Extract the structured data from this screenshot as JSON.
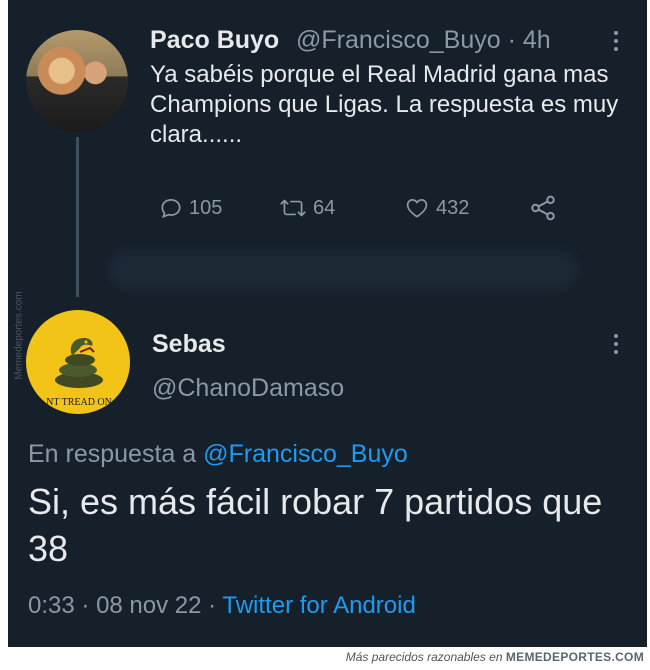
{
  "original_tweet": {
    "display_name": "Paco Buyo",
    "handle": "@Francisco_Buyo",
    "separator": "·",
    "time_ago": "4h",
    "text": "Ya sabéis porque el Real Madrid gana mas Champions que Ligas. La respuesta es muy clara......",
    "stats": {
      "replies": "105",
      "retweets": "64",
      "likes": "432"
    }
  },
  "reply_tweet": {
    "display_name": "Sebas",
    "handle": "@ChanoDamaso",
    "replying_to_prefix": "En respuesta a",
    "replying_to_handle": "@Francisco_Buyo",
    "text": "Si, es más fácil robar 7 partidos que 38",
    "time": "0:33",
    "separator": "·",
    "date": "08 nov 22",
    "source": "Twitter for Android",
    "avatar_caption": "NT TREAD ON"
  },
  "watermark": {
    "side": "Memedeportes.com",
    "footer_caption": "Más parecidos razonables en",
    "footer_brand": "MEMEDEPORTES.COM"
  },
  "colors": {
    "background": "#15202b",
    "primary_text": "#e7e9ea",
    "secondary_text": "#8b98a5",
    "link": "#1d9bf0"
  },
  "icons": [
    "more-icon",
    "reply-icon",
    "retweet-icon",
    "like-icon",
    "share-icon"
  ]
}
